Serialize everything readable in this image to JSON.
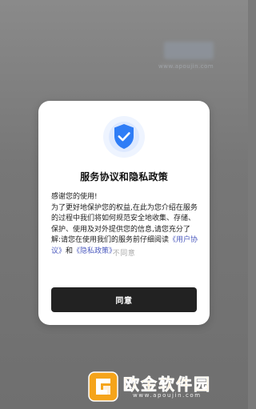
{
  "background": {
    "watermark_small": "www.apoujin.com"
  },
  "dialog": {
    "title": "服务协议和隐私政策",
    "greeting": "感谢您的使用!",
    "body": "为了更好地保护您的权益,在此为您介绍在服务的过程中我们将如何规范安全地收集、存储、保护、使用及对外提供您的信息,请您充分了解:请您在使用我们的服务前仔细阅读",
    "link_user_agreement": "《用户协议》",
    "and": "和",
    "link_privacy_policy": "《隐私政策》",
    "disagree_label": "不同意",
    "agree_label": "同意"
  },
  "watermark": {
    "brand": "欧金软件园",
    "url": "www.apoujin.com"
  },
  "colors": {
    "overlay": "#7a7a7a",
    "dialog_bg": "#ffffff",
    "button_bg": "#222222",
    "link": "#4d5bbf",
    "shield_blue": "#2f7df6",
    "watermark_orange": "#f5a41b"
  },
  "icons": {
    "shield": "shield-check-icon",
    "logo": "apoujin-logo-icon"
  }
}
